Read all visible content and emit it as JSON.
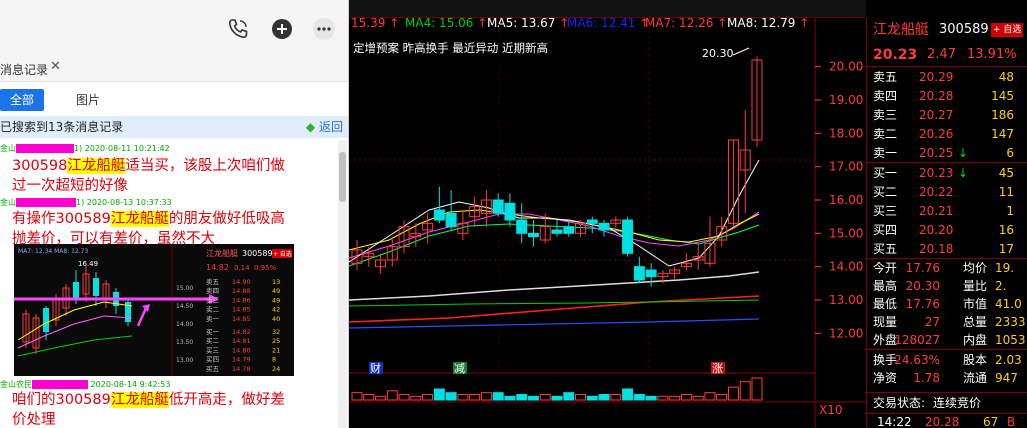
{
  "chat": {
    "tab_title": "消息记录",
    "filter": {
      "all": "全部",
      "images": "图片"
    },
    "search": {
      "result": "已搜索到13条消息记录",
      "back": "返回"
    },
    "messages": [
      {
        "sender": "金山",
        "sender_suffix": "1)",
        "time": "2020-08-11 10:21:42",
        "parts": [
          "300598",
          "江龙船艇",
          "适当买，该股上次咱们做"
        ],
        "line2": "过一次超短的好像"
      },
      {
        "sender": "金山",
        "sender_suffix": "1)",
        "time": "2020-08-13 10:37:33",
        "parts": [
          "有操作300589",
          "江龙船艇",
          "的朋友做好低吸高"
        ],
        "line2": "抛差价，可以有差价，虽然不大"
      },
      {
        "sender": "金山农民",
        "sender_suffix": "",
        "time": "2020-08-14 9:42:53",
        "parts": [
          "咱们的300589",
          "江龙船艇",
          "低开高走，做好差"
        ],
        "line2": "价处理"
      }
    ],
    "thumbnail": {
      "ma_text": "MA7: 12.34  MA8: 12.73",
      "peak": "16.49",
      "stock_name": "江龙船艇",
      "stock_code": "300589",
      "tag": "+ 自选",
      "price": "14.82",
      "change": "0.14",
      "pct": "0.95%",
      "scale": [
        "15.00",
        "14.50",
        "14.00",
        "13.50",
        "13.00"
      ],
      "book": [
        {
          "label": "卖五",
          "price": "14.90",
          "vol": "13"
        },
        {
          "label": "卖四",
          "price": "14.88",
          "vol": "49"
        },
        {
          "label": "卖三",
          "price": "14.86",
          "vol": "49"
        },
        {
          "label": "卖二",
          "price": "14.85",
          "vol": "42"
        },
        {
          "label": "卖一",
          "price": "14.85",
          "vol": "40"
        },
        {
          "label": "买一",
          "price": "14.82",
          "vol": "32"
        },
        {
          "label": "买二",
          "price": "14.81",
          "vol": "25"
        },
        {
          "label": "买三",
          "price": "14.80",
          "vol": "21"
        },
        {
          "label": "买四",
          "price": "14.79",
          "vol": "8"
        },
        {
          "label": "买五",
          "price": "14.78",
          "vol": "24"
        }
      ]
    }
  },
  "chart": {
    "ma": [
      {
        "label": "15.39",
        "color": "#ff3b3b"
      },
      {
        "label": "MA4: 15.06",
        "color": "#00d000"
      },
      {
        "label": "MA5: 13.67",
        "color": "#ffffff"
      },
      {
        "label": "MA6: 12.41",
        "color": "#2020ff"
      },
      {
        "label": "MA7: 12.26",
        "color": "#ff3b3b"
      },
      {
        "label": "MA8: 12.79",
        "color": "#ffffff"
      }
    ],
    "topics": "定增预案  昨高换手  最近异动  近期新高",
    "peak_label": "20.30",
    "price_axis": [
      "20.00",
      "19.00",
      "18.00",
      "17.00",
      "16.00",
      "15.00",
      "14.00",
      "13.00",
      "12.00"
    ],
    "markers": [
      "财",
      "减",
      "涨"
    ],
    "volume_scale": "X10",
    "chart_data": {
      "type": "candlestick",
      "ylim": [
        11.5,
        20.8
      ],
      "candles": [
        [
          14.1,
          14.5,
          13.9,
          14.8
        ],
        [
          14.3,
          14.4,
          14.0,
          14.6
        ],
        [
          14.0,
          14.2,
          13.8,
          14.4
        ],
        [
          14.2,
          14.6,
          14.0,
          14.9
        ],
        [
          14.6,
          15.2,
          14.4,
          15.4
        ],
        [
          14.9,
          15.0,
          14.6,
          15.3
        ],
        [
          15.1,
          15.3,
          14.7,
          15.6
        ],
        [
          15.7,
          15.4,
          15.3,
          16.4
        ],
        [
          15.6,
          15.2,
          15.1,
          16.3
        ],
        [
          15.0,
          15.3,
          14.8,
          15.7
        ],
        [
          15.5,
          15.8,
          15.2,
          16.1
        ],
        [
          15.6,
          16.0,
          15.2,
          16.3
        ],
        [
          16.0,
          15.6,
          15.5,
          16.2
        ],
        [
          15.9,
          15.4,
          15.2,
          16.2
        ],
        [
          15.4,
          15.0,
          14.7,
          15.9
        ],
        [
          15.0,
          14.9,
          14.6,
          15.4
        ],
        [
          14.8,
          15.2,
          14.7,
          15.6
        ],
        [
          15.1,
          15.0,
          14.9,
          15.4
        ],
        [
          15.2,
          15.0,
          14.9,
          15.4
        ],
        [
          15.0,
          15.3,
          14.9,
          15.4
        ],
        [
          15.4,
          15.3,
          15.0,
          15.5
        ],
        [
          15.3,
          15.1,
          14.9,
          15.4
        ],
        [
          15.3,
          15.4,
          15.1,
          15.5
        ],
        [
          15.4,
          14.4,
          14.3,
          15.5
        ],
        [
          14.0,
          13.6,
          13.5,
          14.3
        ],
        [
          13.9,
          13.7,
          13.4,
          14.1
        ],
        [
          13.7,
          13.8,
          13.5,
          13.9
        ],
        [
          13.8,
          13.9,
          13.6,
          14.0
        ],
        [
          14.0,
          14.1,
          13.9,
          14.4
        ],
        [
          14.2,
          14.3,
          13.9,
          14.7
        ],
        [
          14.1,
          14.7,
          14.0,
          15.5
        ],
        [
          14.8,
          15.2,
          14.6,
          15.5
        ],
        [
          15.3,
          17.8,
          15.2,
          17.8
        ],
        [
          16.9,
          17.5,
          15.6,
          18.7
        ],
        [
          17.8,
          20.2,
          17.6,
          20.3
        ]
      ],
      "volume": [
        4,
        3,
        2,
        5,
        3,
        2,
        3,
        6,
        4,
        3,
        3,
        4,
        4,
        2,
        3,
        2,
        3,
        2,
        4,
        3,
        2,
        3,
        3,
        6,
        3,
        2,
        2,
        2,
        3,
        2,
        4,
        3,
        7,
        10,
        12
      ]
    }
  },
  "panel": {
    "name": "江龙船艇",
    "code": "300589",
    "tag": "+ 自选",
    "price": "20.23",
    "change": "2.47",
    "pct": "13.91%",
    "asks": [
      {
        "label": "卖五",
        "price": "20.29",
        "vol": "48",
        "arrow": ""
      },
      {
        "label": "卖四",
        "price": "20.28",
        "vol": "145",
        "arrow": ""
      },
      {
        "label": "卖三",
        "price": "20.27",
        "vol": "186",
        "arrow": ""
      },
      {
        "label": "卖二",
        "price": "20.26",
        "vol": "147",
        "arrow": ""
      },
      {
        "label": "卖一",
        "price": "20.25",
        "vol": "6",
        "arrow": "↓"
      }
    ],
    "bids": [
      {
        "label": "买一",
        "price": "20.23",
        "vol": "45",
        "arrow": "↓"
      },
      {
        "label": "买二",
        "price": "20.22",
        "vol": "11",
        "arrow": ""
      },
      {
        "label": "买三",
        "price": "20.21",
        "vol": "1",
        "arrow": ""
      },
      {
        "label": "买四",
        "price": "20.20",
        "vol": "16",
        "arrow": ""
      },
      {
        "label": "买五",
        "price": "20.18",
        "vol": "17",
        "arrow": ""
      }
    ],
    "stats": [
      {
        "l1": "今开",
        "v1": "17.76",
        "l2": "均价",
        "v2": "19."
      },
      {
        "l1": "最高",
        "v1": "20.30",
        "l2": "量比",
        "v2": "2."
      },
      {
        "l1": "最低",
        "v1": "17.76",
        "l2": "市值",
        "v2": "41.0"
      },
      {
        "l1": "现量",
        "v1": "27",
        "l2": "总量",
        "v2": "2333"
      },
      {
        "l1": "外盘",
        "v1": "128027",
        "l2": "内盘",
        "v2": "1053"
      }
    ],
    "stats2": [
      {
        "l1": "换手",
        "v1": "24.63%",
        "l2": "股本",
        "v2": "2.03"
      },
      {
        "l1": "净资",
        "v1": "1.78",
        "l2": "流通",
        "v2": "947"
      }
    ],
    "trade_status_label": "交易状态:",
    "trade_status_value": "连续竞价",
    "last_tick": {
      "time": "14:22",
      "price": "20.28",
      "vol": "67",
      "flag": "B"
    }
  }
}
